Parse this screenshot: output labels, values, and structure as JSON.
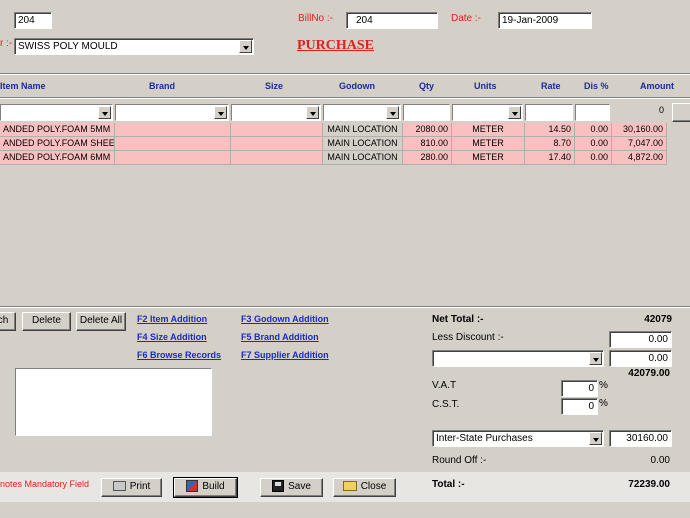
{
  "header": {
    "top_left_value": "204",
    "supplier_label_suffix": "r :-",
    "supplier_value": "SWISS POLY MOULD",
    "billno_label": "BillNo :-",
    "billno_value": "204",
    "date_label": "Date :-",
    "date_value": "19-Jan-2009",
    "form_title": "PURCHASE"
  },
  "grid": {
    "columns": [
      "Item Name",
      "Brand",
      "Size",
      "Godown",
      "Qty",
      "Units",
      "Rate",
      "Dis %",
      "Amount"
    ],
    "filter_count": "0",
    "rows": [
      {
        "item": "ANDED POLY.FOAM 5MM",
        "brand": "",
        "size": "",
        "godown": "MAIN LOCATION",
        "qty": "2080.00",
        "units": "METER",
        "rate": "14.50",
        "dis": "0.00",
        "amount": "30,160.00"
      },
      {
        "item": "ANDED POLY.FOAM SHEET",
        "brand": "",
        "size": "",
        "godown": "MAIN LOCATION",
        "qty": "810.00",
        "units": "METER",
        "rate": "8.70",
        "dis": "0.00",
        "amount": "7,047.00"
      },
      {
        "item": "ANDED POLY.FOAM 6MM",
        "brand": "",
        "size": "",
        "godown": "MAIN LOCATION",
        "qty": "280.00",
        "units": "METER",
        "rate": "17.40",
        "dis": "0.00",
        "amount": "4,872.00"
      }
    ]
  },
  "actions": {
    "search_label": "ch",
    "delete_label": "Delete",
    "delete_all_label": "Delete All"
  },
  "shortcuts": {
    "f2": "F2 Item Addition",
    "f3": "F3 Godown Addition",
    "f4": "F4 Size Addition",
    "f5": "F5 Brand Addition",
    "f6": "F6 Browse Records",
    "f7": "F7 Supplier Addition"
  },
  "summary": {
    "net_total_label": "Net Total :-",
    "net_total_value": "42079",
    "less_discount_label": "Less Discount :-",
    "less_discount_value": "0.00",
    "discount_combo_value": "",
    "discount_amount_value": "0.00",
    "after_discount_value": "42079.00",
    "vat_label": "V.A.T",
    "vat_value": "0",
    "cst_label": "C.S.T.",
    "cst_value": "0",
    "percent_sign": "%",
    "purchase_type_value": "Inter-State Purchases",
    "purchase_type_amount": "30160.00",
    "round_off_label": "Round Off :-",
    "round_off_value": "0.00",
    "total_label": "Total :-",
    "total_value": "72239.00"
  },
  "footer": {
    "mandatory_note": "notes Mandatory Field",
    "print_label": "Print",
    "build_label": "Build",
    "save_label": "Save",
    "close_label": "Close"
  },
  "colors": {
    "background": "#d4d0c8",
    "mandatory_row": "#f8c0c0",
    "header_text": "#1a2a9c",
    "title_red": "#e02020",
    "link_blue": "#1a2ac8"
  }
}
